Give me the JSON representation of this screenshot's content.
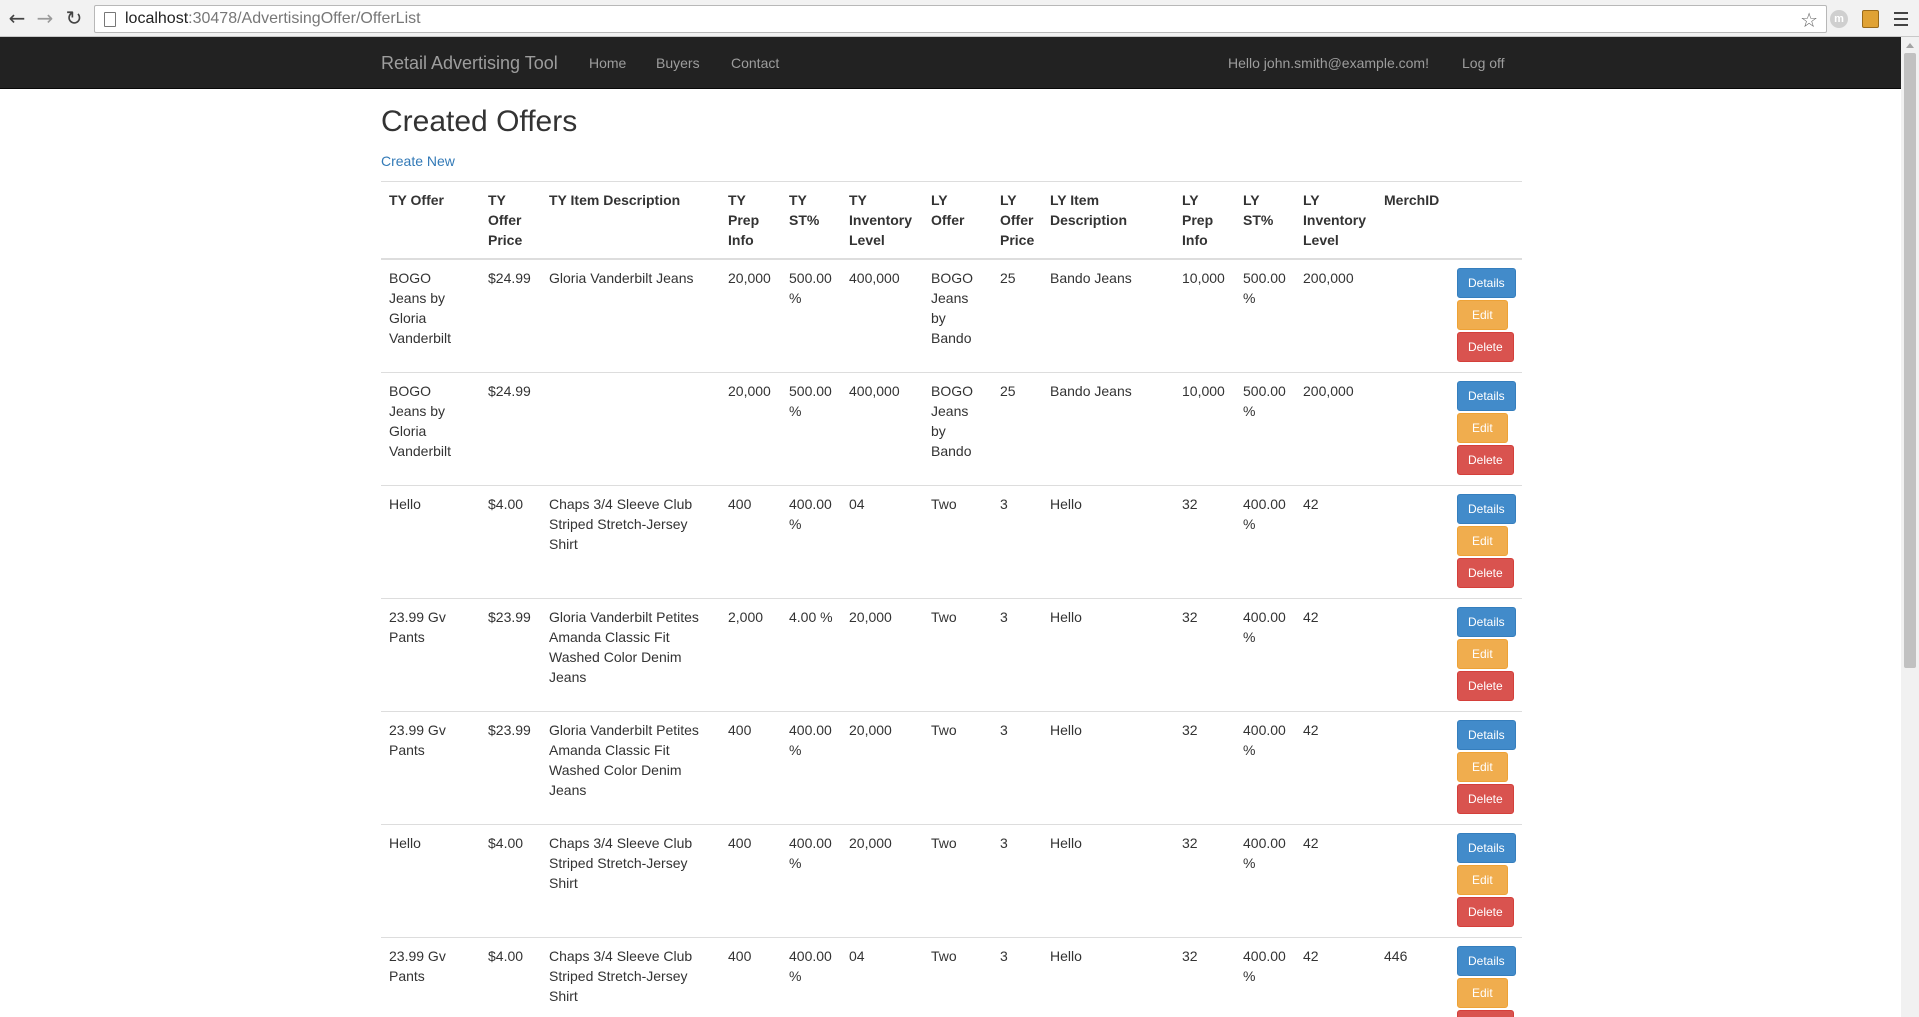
{
  "browser": {
    "url_host": "localhost",
    "url_path": ":30478/AdvertisingOffer/OfferList"
  },
  "navbar": {
    "brand": "Retail Advertising Tool",
    "links": [
      "Home",
      "Buyers",
      "Contact"
    ],
    "greeting": "Hello john.smith@example.com!",
    "logoff": "Log off"
  },
  "page": {
    "title": "Created Offers",
    "create_new": "Create New"
  },
  "table": {
    "headers": [
      "TY Offer",
      "TY Offer Price",
      "TY Item Description",
      "TY Prep Info",
      "TY ST%",
      "TY Inventory Level",
      "LY Offer",
      "LY Offer Price",
      "LY Item Description",
      "LY Prep Info",
      "LY ST%",
      "LY Inventory Level",
      "MerchID",
      ""
    ],
    "buttons": {
      "details": "Details",
      "edit": "Edit",
      "delete": "Delete"
    },
    "rows": [
      [
        "BOGO Jeans by Gloria Vanderbilt",
        "$24.99",
        "Gloria Vanderbilt Jeans",
        "20,000",
        "500.00 %",
        "400,000",
        "BOGO Jeans by Bando",
        "25",
        "Bando Jeans",
        "10,000",
        "500.00 %",
        "200,000",
        ""
      ],
      [
        "BOGO Jeans by Gloria Vanderbilt",
        "$24.99",
        "",
        "20,000",
        "500.00 %",
        "400,000",
        "BOGO Jeans by Bando",
        "25",
        "Bando Jeans",
        "10,000",
        "500.00 %",
        "200,000",
        ""
      ],
      [
        "Hello",
        "$4.00",
        "Chaps 3/4 Sleeve Club Striped Stretch-Jersey Shirt",
        "400",
        "400.00 %",
        "04",
        "Two",
        "3",
        "Hello",
        "32",
        "400.00 %",
        "42",
        ""
      ],
      [
        "23.99 Gv Pants",
        "$23.99",
        "Gloria Vanderbilt Petites Amanda Classic Fit Washed Color Denim Jeans",
        "2,000",
        "4.00 %",
        "20,000",
        "Two",
        "3",
        "Hello",
        "32",
        "400.00 %",
        "42",
        ""
      ],
      [
        "23.99 Gv Pants",
        "$23.99",
        "Gloria Vanderbilt Petites Amanda Classic Fit Washed Color Denim Jeans",
        "400",
        "400.00 %",
        "20,000",
        "Two",
        "3",
        "Hello",
        "32",
        "400.00 %",
        "42",
        ""
      ],
      [
        "Hello",
        "$4.00",
        "Chaps 3/4 Sleeve Club Striped Stretch-Jersey Shirt",
        "400",
        "400.00 %",
        "20,000",
        "Two",
        "3",
        "Hello",
        "32",
        "400.00 %",
        "42",
        ""
      ],
      [
        "23.99 Gv Pants",
        "$4.00",
        "Chaps 3/4 Sleeve Club Striped Stretch-Jersey Shirt",
        "400",
        "400.00 %",
        "04",
        "Two",
        "3",
        "Hello",
        "32",
        "400.00 %",
        "42",
        "446"
      ]
    ]
  }
}
